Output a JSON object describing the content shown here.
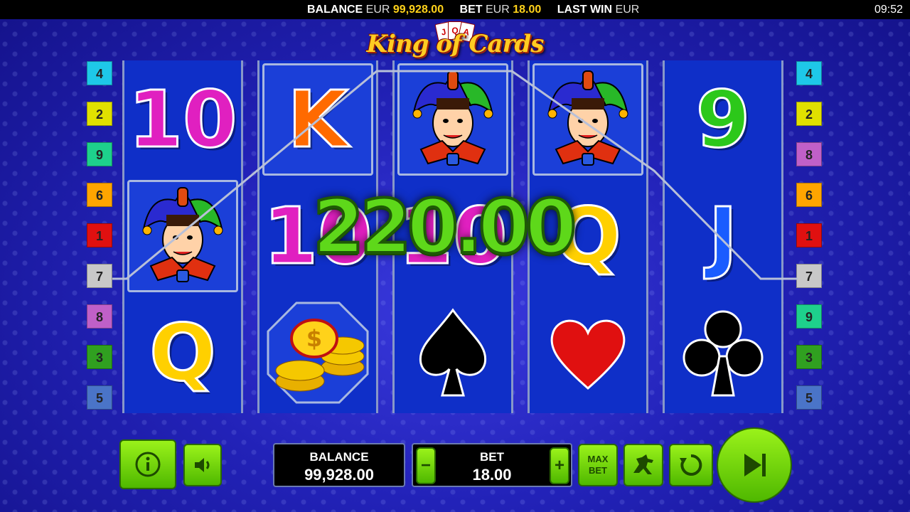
{
  "topbar": {
    "balance_label": "BALANCE",
    "balance_currency": "EUR",
    "balance_value": "99,928.00",
    "bet_label": "BET",
    "bet_currency": "EUR",
    "bet_value": "18.00",
    "last_win_label": "LAST WIN",
    "last_win_currency": "EUR",
    "clock": "09:52"
  },
  "logo": {
    "text": "King of Cards",
    "card_glyphs": [
      "J",
      "Q",
      "A"
    ]
  },
  "paylines": {
    "left": [
      {
        "num": "4",
        "color": "#1ec8e8"
      },
      {
        "num": "2",
        "color": "#e0e000"
      },
      {
        "num": "9",
        "color": "#1ed08c"
      },
      {
        "num": "6",
        "color": "#ffa500"
      },
      {
        "num": "1",
        "color": "#e01010"
      },
      {
        "num": "7",
        "color": "#c8c8c8"
      },
      {
        "num": "8",
        "color": "#c060c8"
      },
      {
        "num": "3",
        "color": "#30a020"
      },
      {
        "num": "5",
        "color": "#4a74c8"
      }
    ],
    "right": [
      {
        "num": "4",
        "color": "#1ec8e8"
      },
      {
        "num": "2",
        "color": "#e0e000"
      },
      {
        "num": "8",
        "color": "#c060c8"
      },
      {
        "num": "6",
        "color": "#ffa500"
      },
      {
        "num": "1",
        "color": "#e01010"
      },
      {
        "num": "7",
        "color": "#c8c8c8"
      },
      {
        "num": "9",
        "color": "#1ed08c"
      },
      {
        "num": "3",
        "color": "#30a020"
      },
      {
        "num": "5",
        "color": "#4a74c8"
      }
    ]
  },
  "reels": [
    [
      "10",
      "joker",
      "Q"
    ],
    [
      "K",
      "10",
      "coins"
    ],
    [
      "joker",
      "10",
      "spade"
    ],
    [
      "joker",
      "Q",
      "heart"
    ],
    [
      "9",
      "J",
      "club"
    ]
  ],
  "symbol_colors": {
    "10": "#e020c0",
    "K": "#ff6a00",
    "Q": "#ffd000",
    "J": "#1a5cff",
    "9": "#2cc81a"
  },
  "win_amount": "220.00",
  "controls": {
    "balance_label": "BALANCE",
    "balance_value": "99,928.00",
    "bet_label": "BET",
    "bet_value": "18.00",
    "minus": "−",
    "plus": "+",
    "max_bet": "MAX BET"
  }
}
